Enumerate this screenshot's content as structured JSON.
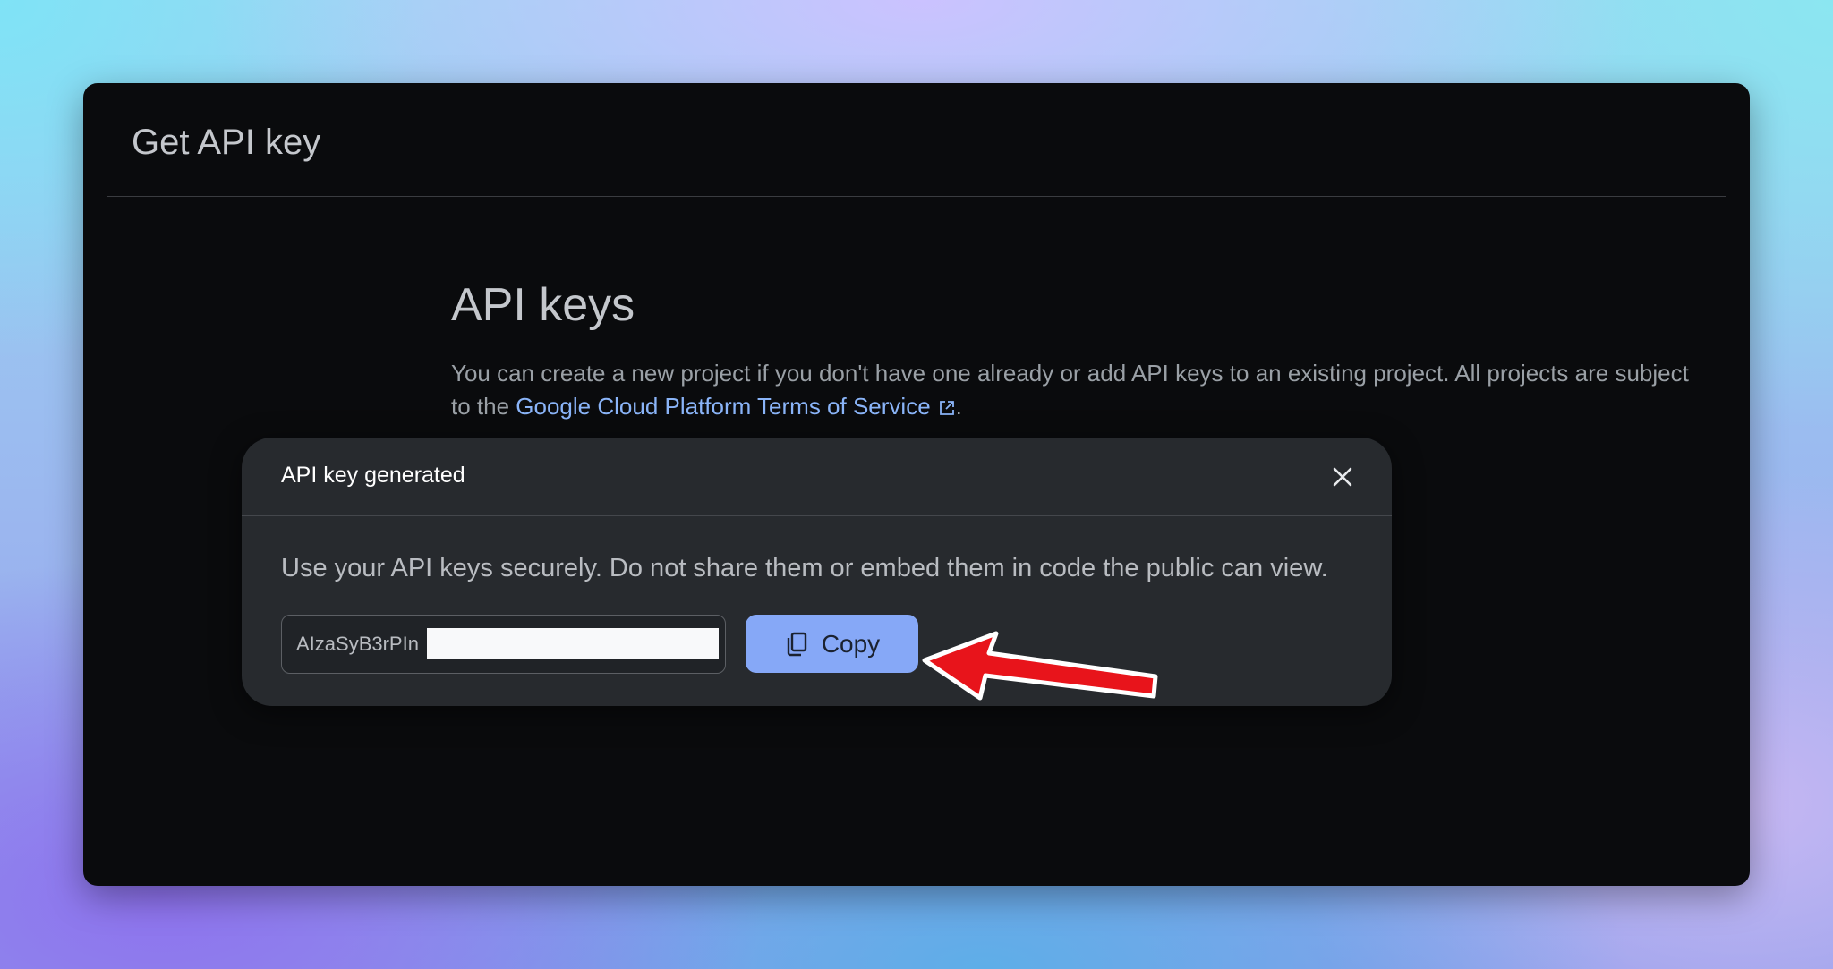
{
  "page": {
    "title": "Get API key"
  },
  "section": {
    "title": "API keys",
    "desc_prefix": "You can create a new project if you don't have one already or add API keys to an existing project. All projects are subject to the ",
    "link_text": "Google Cloud Platform Terms of Service",
    "desc_suffix": "."
  },
  "dialog": {
    "title": "API key generated",
    "message": "Use your API keys securely. Do not share them or embed them in code the public can view.",
    "key_value_visible": "AIzaSyB3rPIn",
    "copy_label": "Copy",
    "close_icon": "close-icon",
    "copy_icon": "copy-icon"
  },
  "annotation": {
    "arrow_color": "#e8141b"
  },
  "colors": {
    "accent": "#8ab4f8",
    "button_bg": "#86a8f7",
    "dialog_bg": "#272a2e",
    "window_bg": "#0a0b0d"
  }
}
